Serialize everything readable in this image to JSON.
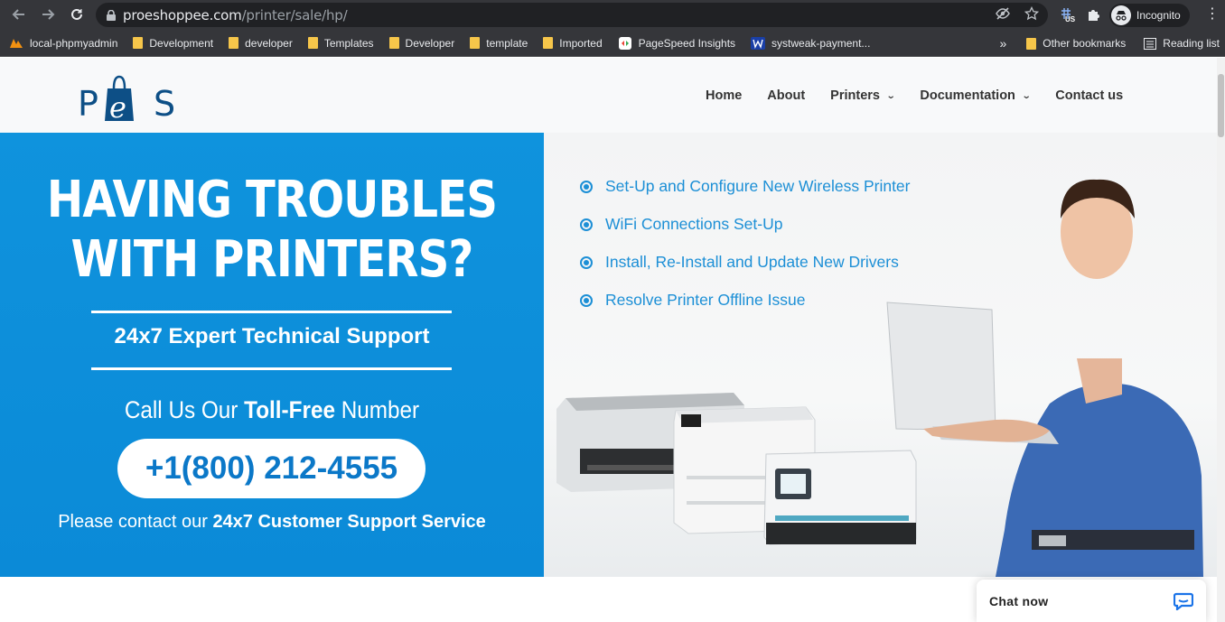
{
  "browser": {
    "url_domain": "proeshoppee.com",
    "url_path": "/printer/sale/hp/",
    "profile_label": "Incognito",
    "extension_badge": "US",
    "bookmarks": [
      {
        "label": "local-phpmyadmin",
        "icon": "phpmyadmin-icon"
      },
      {
        "label": "Development",
        "icon": "folder-icon"
      },
      {
        "label": "developer",
        "icon": "folder-icon"
      },
      {
        "label": "Templates",
        "icon": "folder-icon"
      },
      {
        "label": "Developer",
        "icon": "folder-icon"
      },
      {
        "label": "template",
        "icon": "folder-icon"
      },
      {
        "label": "Imported",
        "icon": "folder-icon"
      },
      {
        "label": "PageSpeed Insights",
        "icon": "pagespeed-icon"
      },
      {
        "label": "systweak-payment...",
        "icon": "systweak-icon"
      }
    ],
    "more_bookmarks": "»",
    "other_bookmarks": "Other bookmarks",
    "reading_list": "Reading list"
  },
  "site": {
    "logo_left": "P",
    "logo_mid": "e",
    "logo_right": "S",
    "nav": {
      "home": "Home",
      "about": "About",
      "printers": "Printers",
      "documentation": "Documentation",
      "contact": "Contact us"
    }
  },
  "banner": {
    "headline_1": "HAVING TROUBLES",
    "headline_2": "WITH PRINTERS?",
    "support": "24x7 Expert Technical Support",
    "call_pre": "Call Us Our ",
    "call_bold": "Toll-Free",
    "call_post": " Number",
    "phone": "+1(800) 212-4555",
    "contact_pre": "Please contact our ",
    "contact_bold": "24x7 Customer Support Service",
    "features": [
      "Set-Up and Configure New Wireless Printer",
      "WiFi Connections Set-Up",
      "Install, Re-Install and Update New Drivers",
      "Resolve Printer Offline Issue"
    ]
  },
  "chat": {
    "label": "Chat now"
  },
  "colors": {
    "banner_blue": "#0f93dd",
    "feature_blue": "#1c8fd6",
    "logo_navy": "#0d4f86"
  }
}
